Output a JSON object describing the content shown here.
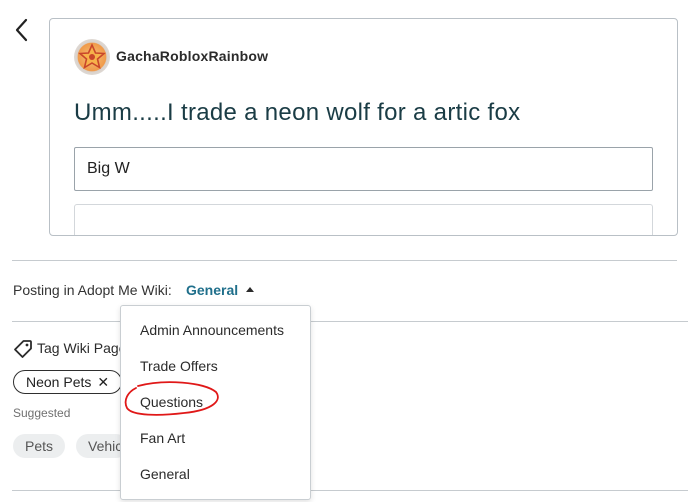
{
  "header": {
    "back_icon": "chevron-left-icon"
  },
  "post": {
    "username": "GachaRobloxRainbow",
    "avatar_icon": "star-badge-icon",
    "title": "Umm.....I trade a neon wolf for a artic fox",
    "body_value": "Big W"
  },
  "posting": {
    "prefix": "Posting in Adopt Me Wiki:",
    "category": "General",
    "caret_icon": "caret-up-icon"
  },
  "dropdown": {
    "items": [
      "Admin Announcements",
      "Trade Offers",
      "Questions",
      "Fan Art",
      "General"
    ]
  },
  "tags": {
    "label": "Tag Wiki Pages",
    "label_icon": "tag-icon",
    "selected": [
      {
        "label": "Neon Pets",
        "remove_glyph": "✕"
      }
    ],
    "suggested_label": "Suggested",
    "suggested": [
      "Pets",
      "Vehicles"
    ]
  },
  "colors": {
    "accent": "#1f6f8b",
    "title": "#1a3c45",
    "annotation": "#e01818"
  }
}
